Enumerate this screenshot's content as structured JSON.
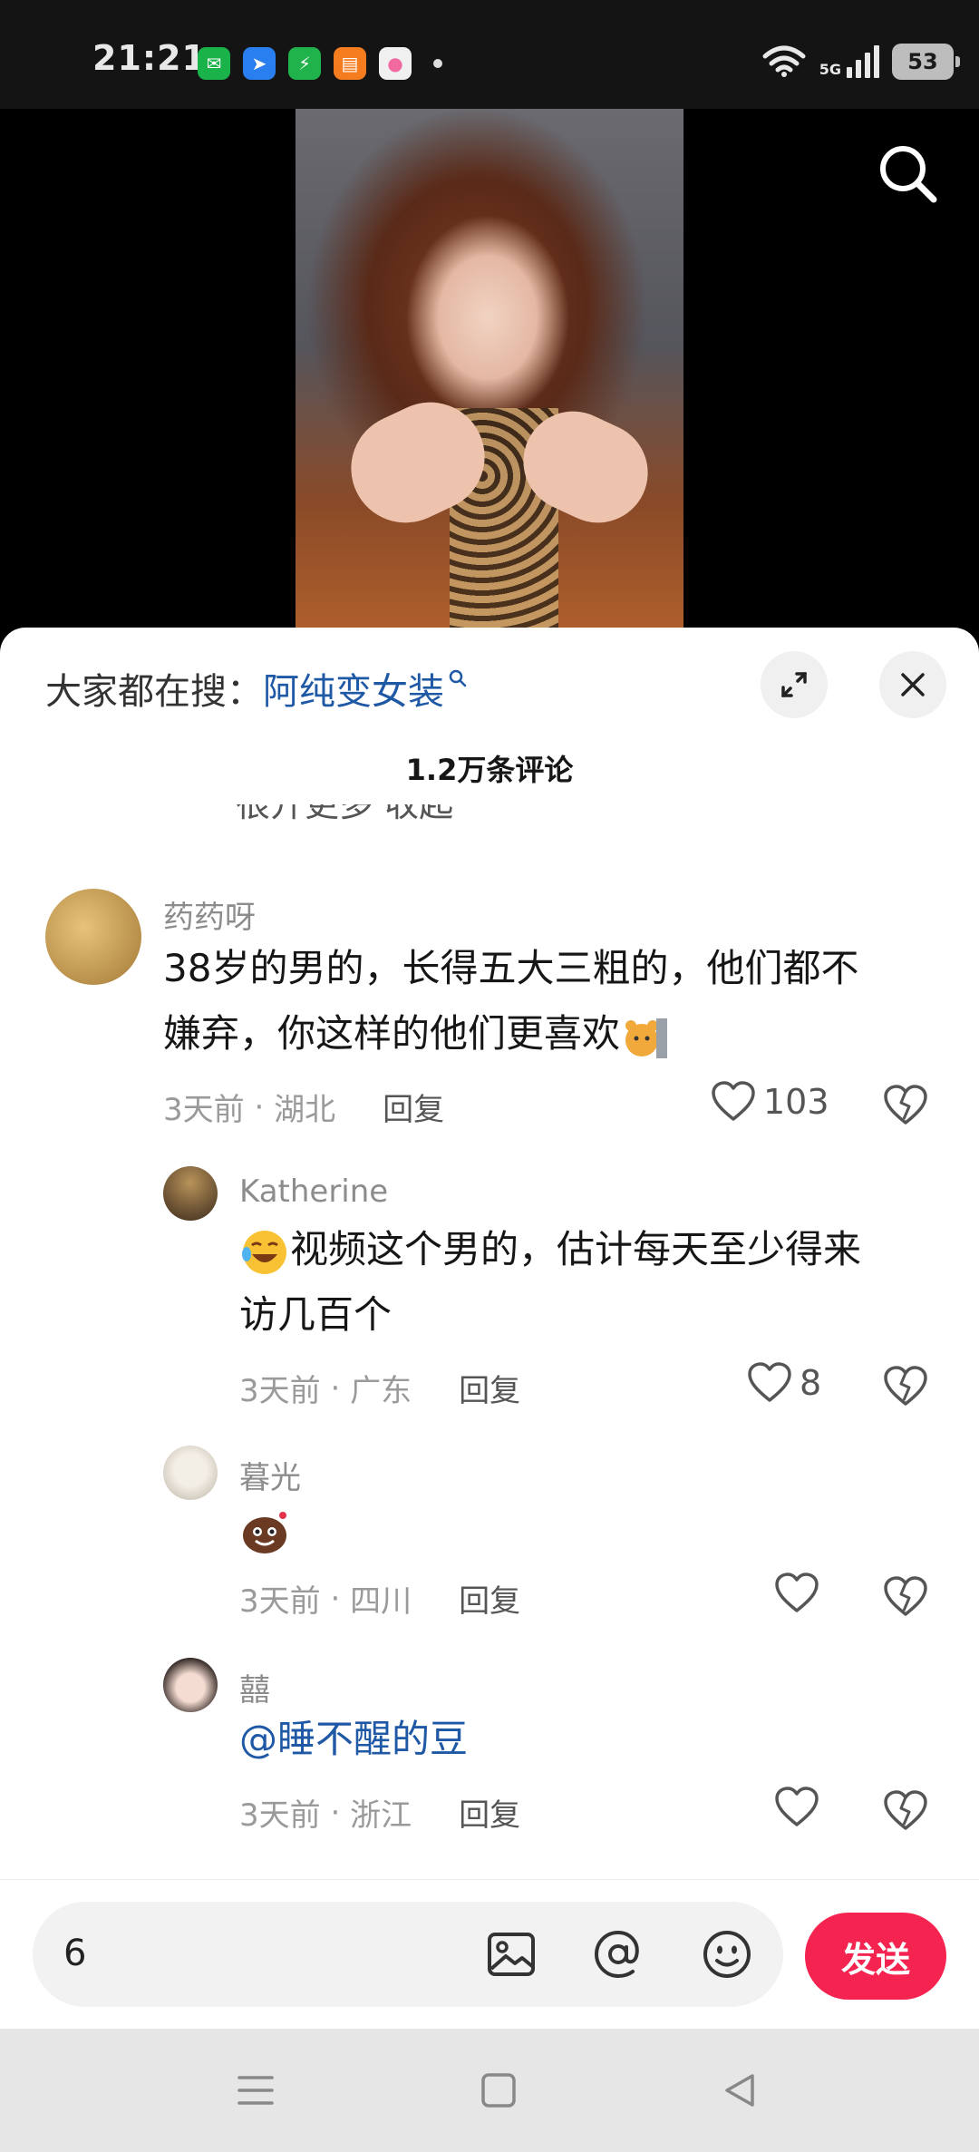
{
  "status_bar": {
    "time": "21:21",
    "network": "5G",
    "battery": "53",
    "app_icons": [
      {
        "name": "wechat-icon",
        "color": "#19b34a",
        "glyph": "✉"
      },
      {
        "name": "app-blue-icon",
        "color": "#2a7ff0",
        "glyph": "➤"
      },
      {
        "name": "security-app-icon",
        "color": "#20b24b",
        "glyph": "⚡"
      },
      {
        "name": "orange-app-icon",
        "color": "#f57c1f",
        "glyph": "▤"
      },
      {
        "name": "pink-app-icon",
        "color": "#f0f0f0",
        "glyph": "●"
      }
    ]
  },
  "sheet": {
    "trend_label": "大家都在搜：",
    "trend_query": "阿纯变女装",
    "comment_count": "1.2万条评论",
    "clipped_text": "很开更多    收起"
  },
  "comments": [
    {
      "user": "药药呀",
      "text_line1": "38岁的男的，长得五大三粗的，他们都不",
      "text_line2": "嫌弃，你这样的他们更喜欢",
      "time": "3天前",
      "location": "湖北",
      "reply": "回复",
      "likes": "103",
      "avatar_color": "#caa35a"
    },
    {
      "user": "Katherine",
      "text_line1": "视频这个男的，估计每天至少得来",
      "text_line2": "访几百个",
      "time": "3天前",
      "location": "广东",
      "reply": "回复",
      "likes": "8",
      "avatar_color": "#6b4a2e"
    },
    {
      "user": "暮光",
      "text_line1": "",
      "time": "3天前",
      "location": "四川",
      "reply": "回复",
      "likes": "",
      "avatar_color": "#d9d2c4"
    },
    {
      "user": "囍",
      "text_line1": "@睡不醒的豆",
      "time": "3天前",
      "location": "浙江",
      "reply": "回复",
      "likes": "",
      "avatar_color": "#e9d6d0"
    }
  ],
  "input": {
    "value": "6",
    "send_label": "发送"
  },
  "colors": {
    "accent": "#f5234f",
    "link": "#1f58a5"
  }
}
